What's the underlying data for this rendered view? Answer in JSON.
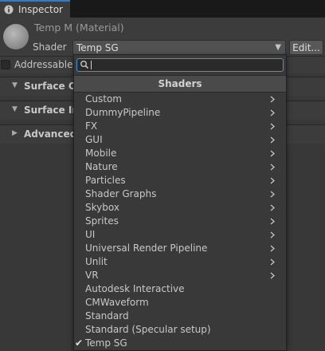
{
  "window": {
    "tab_title": "Inspector",
    "tab_icon": "info-icon"
  },
  "material": {
    "title": "Temp M (Material)",
    "shader_label": "Shader",
    "shader_value": "Temp SG",
    "edit_label": "Edit...",
    "addressable_label": "Addressable",
    "addressable_checked": false
  },
  "sections": [
    {
      "label": "Surface Op",
      "expanded": true
    },
    {
      "label": "Surface Inp",
      "expanded": true
    },
    {
      "label": "Advanced",
      "expanded": false
    }
  ],
  "dropdown": {
    "search_value": "",
    "header": "Shaders",
    "items": [
      {
        "label": "Custom",
        "submenu": true,
        "checked": false
      },
      {
        "label": "DummyPipeline",
        "submenu": true,
        "checked": false
      },
      {
        "label": "FX",
        "submenu": true,
        "checked": false
      },
      {
        "label": "GUI",
        "submenu": true,
        "checked": false
      },
      {
        "label": "Mobile",
        "submenu": true,
        "checked": false
      },
      {
        "label": "Nature",
        "submenu": true,
        "checked": false
      },
      {
        "label": "Particles",
        "submenu": true,
        "checked": false
      },
      {
        "label": "Shader Graphs",
        "submenu": true,
        "checked": false
      },
      {
        "label": "Skybox",
        "submenu": true,
        "checked": false
      },
      {
        "label": "Sprites",
        "submenu": true,
        "checked": false
      },
      {
        "label": "UI",
        "submenu": true,
        "checked": false
      },
      {
        "label": "Universal Render Pipeline",
        "submenu": true,
        "checked": false
      },
      {
        "label": "Unlit",
        "submenu": true,
        "checked": false
      },
      {
        "label": "VR",
        "submenu": true,
        "checked": false
      },
      {
        "label": "Autodesk Interactive",
        "submenu": false,
        "checked": false
      },
      {
        "label": "CMWaveform",
        "submenu": false,
        "checked": false
      },
      {
        "label": "Standard",
        "submenu": false,
        "checked": false
      },
      {
        "label": "Standard (Specular setup)",
        "submenu": false,
        "checked": false
      },
      {
        "label": "Temp SG",
        "submenu": false,
        "checked": true
      }
    ]
  },
  "colors": {
    "accent": "#3a79bb",
    "focus": "#4a90d9",
    "background": "#383838"
  }
}
